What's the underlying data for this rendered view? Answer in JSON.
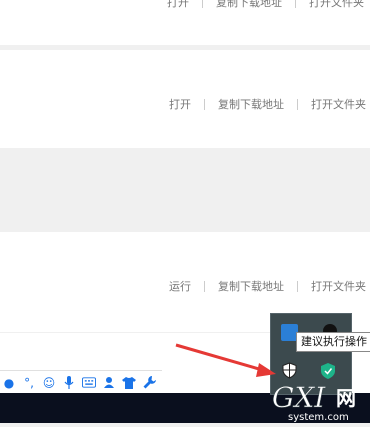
{
  "rows": [
    {
      "id": "top",
      "actions": [
        "打开",
        "复制下载地址",
        "打开文件夹"
      ]
    },
    {
      "id": "mid",
      "actions": [
        "打开",
        "复制下载地址",
        "打开文件夹"
      ]
    },
    {
      "id": "bottom",
      "actions": [
        "运行",
        "复制下载地址",
        "打开文件夹"
      ]
    }
  ],
  "tooltip": "建议执行操作",
  "watermark": {
    "brand": "GXI",
    "net": "网",
    "domain": "system.com"
  },
  "input_bar_icons": [
    "dot-icon",
    "quote-icon",
    "smiley-icon",
    "microphone-icon",
    "keyboard-icon",
    "user-icon",
    "shirt-icon",
    "wrench-icon"
  ],
  "colors": {
    "accent": "#1a73e8",
    "arrow": "#e53935",
    "taskbar": "#0a0f1e"
  }
}
